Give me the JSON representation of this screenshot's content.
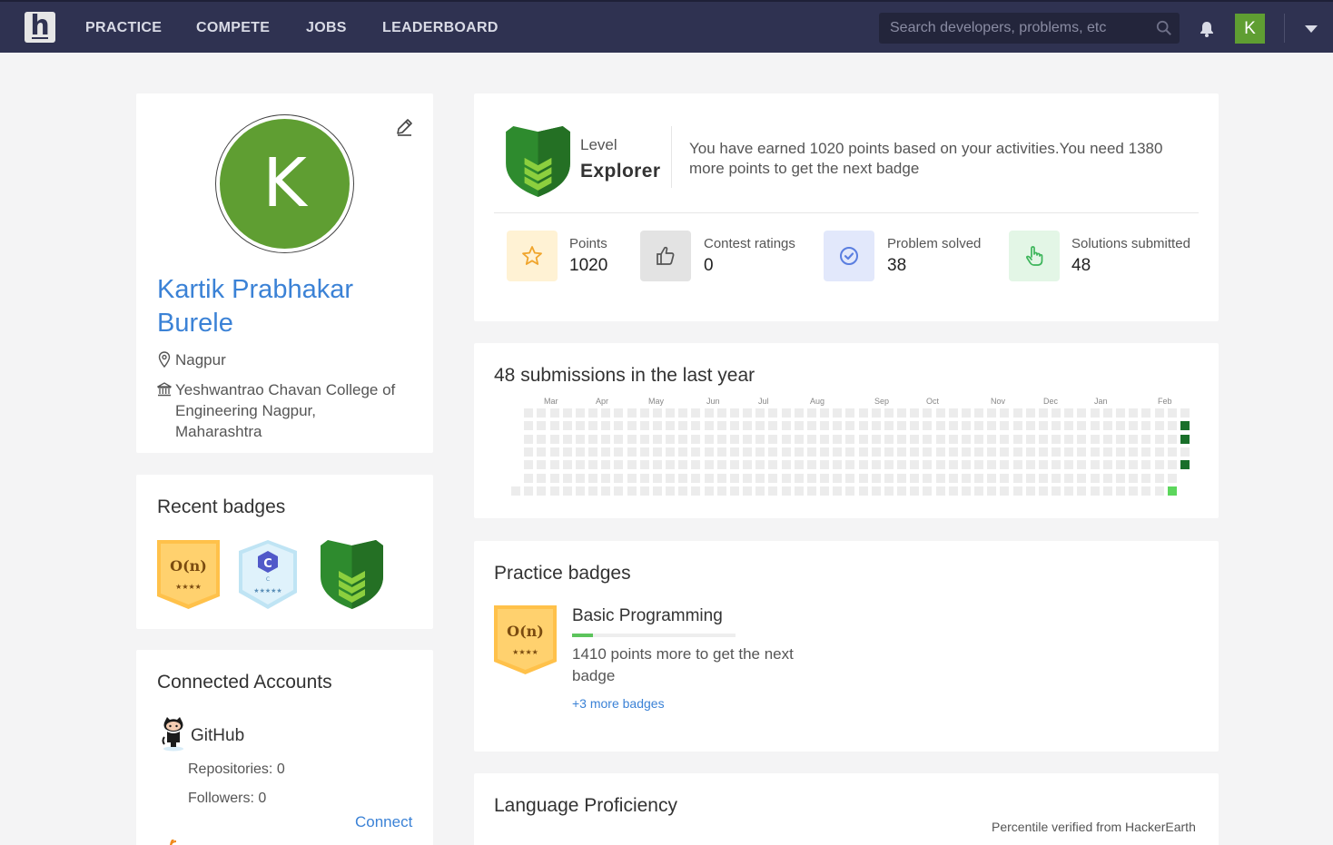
{
  "nav": {
    "logo": "h",
    "links": [
      "PRACTICE",
      "COMPETE",
      "JOBS",
      "LEADERBOARD"
    ],
    "search_placeholder": "Search developers, problems, etc",
    "avatar_letter": "K"
  },
  "profile": {
    "avatar_letter": "K",
    "name": "Kartik Prabhakar Burele",
    "location": "Nagpur",
    "college": "Yeshwantrao Chavan College of Engineering Nagpur, Maharashtra"
  },
  "recent_badges": {
    "title": "Recent badges",
    "items": [
      {
        "icon": "o-n-gold-badge",
        "text": "O(n)",
        "stars": "★★★★",
        "color": "#ffc14a"
      },
      {
        "icon": "c-language-badge",
        "text": "C",
        "sub": "C",
        "stars": "★★★★★",
        "color": "#d6eff9"
      },
      {
        "icon": "explorer-shield-badge",
        "color": "#2e8b2e"
      }
    ]
  },
  "connected": {
    "title": "Connected Accounts",
    "github": {
      "name": "GitHub",
      "repos": "Repositories: 0",
      "followers": "Followers: 0",
      "connect": "Connect"
    }
  },
  "level": {
    "label": "Level",
    "name": "Explorer",
    "message": "You have earned 1020 points based on your activities.You need 1380 more points to get the next badge",
    "colors": {
      "shield": "#2e8b2e",
      "chevron": "#8ccf3e"
    }
  },
  "stats": [
    {
      "label": "Points",
      "value": "1020",
      "icon": "star-icon",
      "bg": "#fff2d4",
      "color": "#f0a52c"
    },
    {
      "label": "Contest ratings",
      "value": "0",
      "icon": "thumbs-up-icon",
      "bg": "#e3e3e3",
      "color": "#555555"
    },
    {
      "label": "Problem solved",
      "value": "38",
      "icon": "check-circle-icon",
      "bg": "#e2e8fb",
      "color": "#5a7ee0"
    },
    {
      "label": "Solutions submitted",
      "value": "48",
      "icon": "pointer-hand-icon",
      "bg": "#e3f6e6",
      "color": "#3cb55a"
    }
  ],
  "submissions": {
    "title": "48 submissions in the last year",
    "months": [
      "Mar",
      "Apr",
      "May",
      "Jun",
      "Jul",
      "Aug",
      "Sep",
      "Oct",
      "Nov",
      "Dec",
      "Jan",
      "Feb"
    ],
    "active_cells": [
      {
        "week": 52,
        "day": 1,
        "level": "dark"
      },
      {
        "week": 52,
        "day": 2,
        "level": "dark"
      },
      {
        "week": 52,
        "day": 4,
        "level": "dark"
      },
      {
        "week": 51,
        "day": 6,
        "level": "light"
      }
    ],
    "colors": {
      "empty": "#ececec",
      "dark": "#196f2a",
      "light": "#5cd65c"
    }
  },
  "practice_badges": {
    "title": "Practice badges",
    "badge_text": "O(n)",
    "badge_stars": "★★★★",
    "name": "Basic Programming",
    "progress": 0.13,
    "desc": "1410 points more to get the next badge",
    "more": "+3 more badges"
  },
  "language": {
    "title": "Language Proficiency",
    "sub": "Percentile verified from HackerEarth"
  }
}
